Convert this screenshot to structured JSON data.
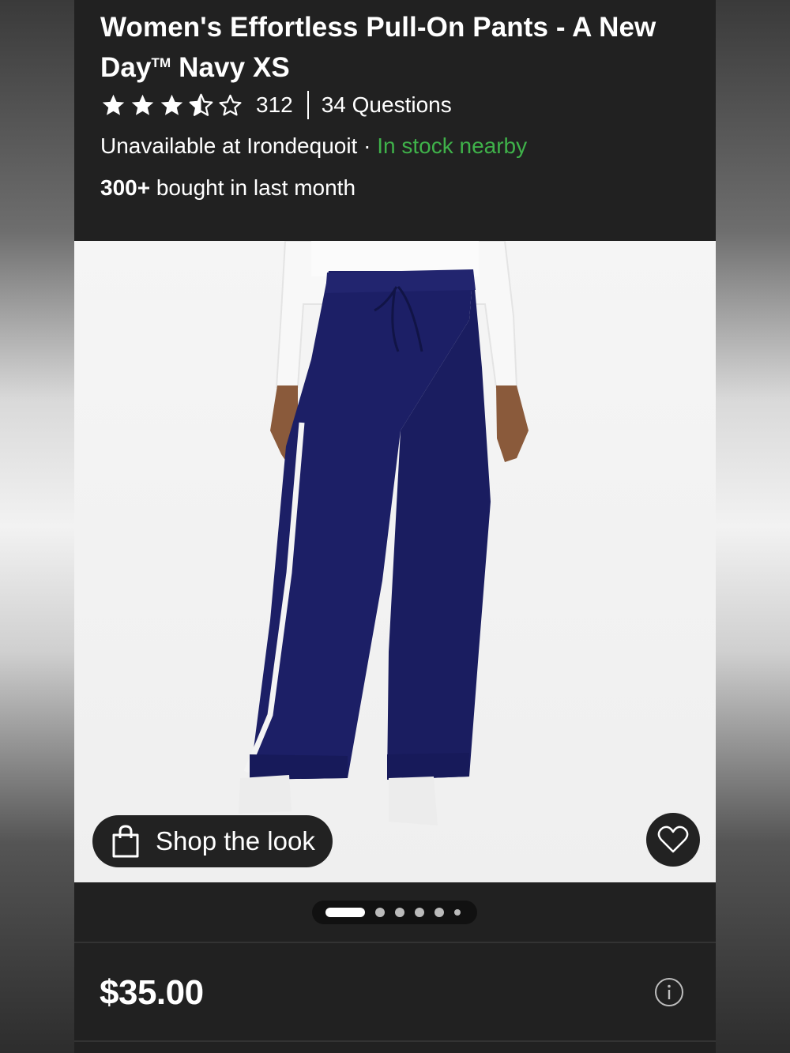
{
  "product": {
    "title_main": "Women's Effortless Pull-On Pants - A New Day",
    "title_tm": "TM",
    "title_tail": " Navy XS"
  },
  "rating": {
    "stars": 3.5,
    "max_stars": 5,
    "review_count": "312",
    "questions": "34 Questions"
  },
  "availability": {
    "store_text": "Unavailable at Irondequoit",
    "separator": " · ",
    "nearby_text": "In stock nearby",
    "nearby_color": "#3fb24a"
  },
  "social_proof": {
    "count": "300+",
    "text": " bought in last month"
  },
  "image": {
    "shop_the_look_label": "Shop the look",
    "favorite_icon": "heart-icon",
    "carousel_total": 6,
    "carousel_active": 1
  },
  "price": {
    "amount": "$35.00",
    "info_icon": "info-icon"
  },
  "colors": {
    "background": "#212121",
    "pants": "#1c1f66",
    "text": "#ffffff"
  }
}
